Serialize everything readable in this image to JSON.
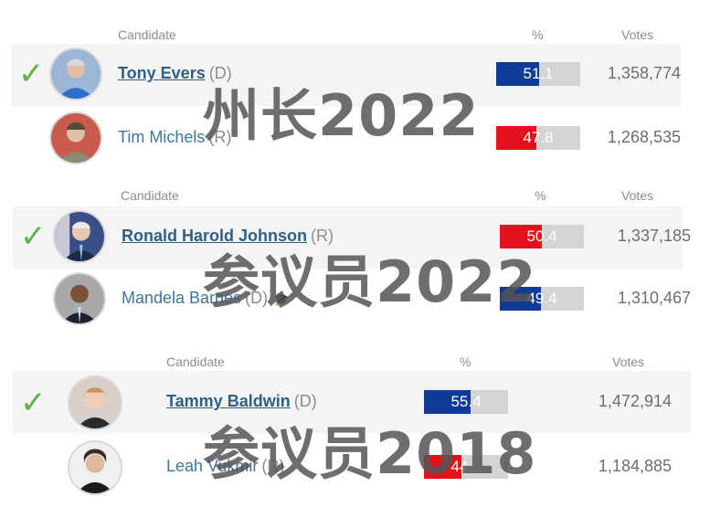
{
  "colors": {
    "dem": "#0f3b96",
    "rep": "#e3111b",
    "check": "#5fb24a",
    "bar_bg": "#d4d4d4"
  },
  "races": [
    {
      "overlay": "州长2022",
      "headers": {
        "candidate": "Candidate",
        "percent": "%",
        "votes": "Votes"
      },
      "candidates": [
        {
          "name": "Tony Evers",
          "party": "(D)",
          "percent": "51.1",
          "votes": "1,358,774",
          "winner": true,
          "color": "#0f3b96"
        },
        {
          "name": "Tim Michels",
          "party": "(R)",
          "percent": "47.8",
          "votes": "1,268,535",
          "winner": false,
          "color": "#e3111b"
        }
      ]
    },
    {
      "overlay": "参议员2022",
      "headers": {
        "candidate": "Candidate",
        "percent": "%",
        "votes": "Votes"
      },
      "candidates": [
        {
          "name": "Ronald Harold Johnson",
          "party": "(R)",
          "percent": "50.4",
          "votes": "1,337,185",
          "winner": true,
          "color": "#e3111b"
        },
        {
          "name": "Mandela Barnes",
          "party": "(D)",
          "percent": "49.4",
          "votes": "1,310,467",
          "winner": false,
          "color": "#0f3b96",
          "icon": "graduation-cap-icon"
        }
      ]
    },
    {
      "overlay": "参议员2018",
      "headers": {
        "candidate": "Candidate",
        "percent": "%",
        "votes": "Votes"
      },
      "candidates": [
        {
          "name": "Tammy Baldwin",
          "party": "(D)",
          "percent": "55.4",
          "votes": "1,472,914",
          "winner": true,
          "color": "#0f3b96"
        },
        {
          "name": "Leah Vukmir",
          "party": "(R)",
          "percent": "44.6",
          "votes": "1,184,885",
          "winner": false,
          "color": "#e3111b"
        }
      ]
    }
  ]
}
